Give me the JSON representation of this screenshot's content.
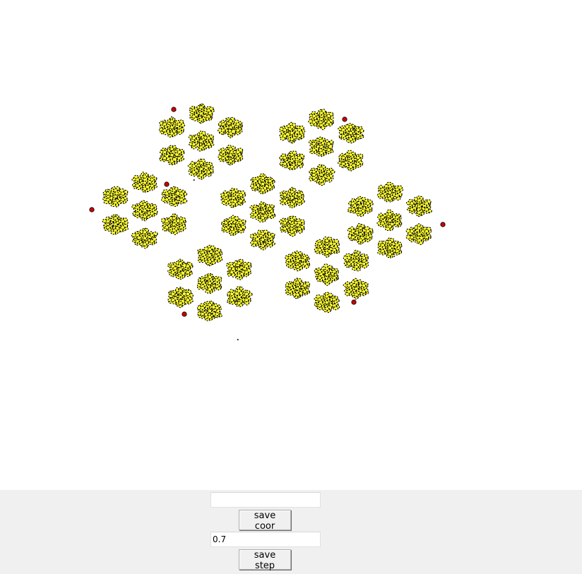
{
  "canvas": {
    "background": "#ffffff",
    "fractal_fill": "#ffff33",
    "fractal_stroke": "#000000",
    "marker_color": "#cc0000"
  },
  "controls": {
    "coor_input_value": "",
    "save_coor_label": "save coor",
    "step_input_value": "0.7",
    "save_step_label": "save step"
  }
}
